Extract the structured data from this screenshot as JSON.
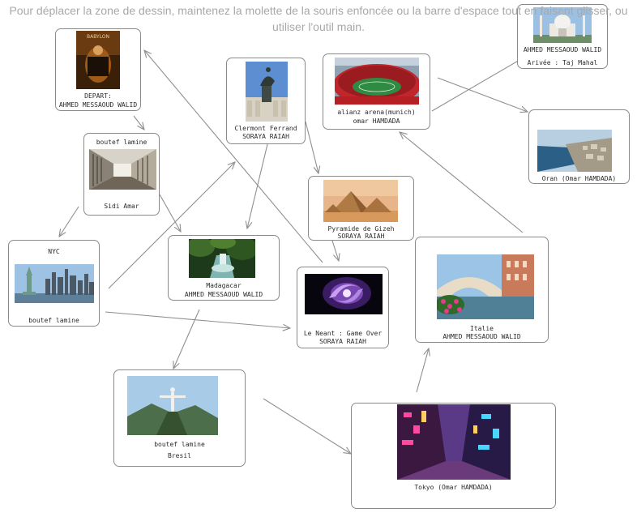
{
  "hint": "Pour déplacer la zone de dessin, maintenez la molette de la souris enfoncée ou la barre d'espace tout en faisant glisser, ou utiliser l'outil main.",
  "cards": {
    "depart": {
      "title": "DEPART:",
      "subtitle": "AHMED MESSAOUD WALID",
      "image_subject": "Babylon movie poster"
    },
    "boutef_sidi": {
      "title": "boutef lamine",
      "subtitle": "Sidi Amar",
      "image_subject": "prison corridor"
    },
    "nyc": {
      "title": "NYC",
      "subtitle": "boutef lamine",
      "image_subject": "Statue of Liberty and Manhattan skyline"
    },
    "clermont": {
      "title": "Clermont Ferrand",
      "subtitle": "SORAYA RAIAH",
      "image_subject": "equestrian statue and building"
    },
    "allianz": {
      "title": "alianz arena(munich)",
      "subtitle": "omar HAMDADA",
      "image_subject": "stadium"
    },
    "taj": {
      "title": "AHMED MESSAOUD WALID",
      "subtitle": "Arivée : Taj Mahal",
      "image_subject": "Taj Mahal"
    },
    "oran": {
      "title": "Oran (Omar HAMDADA)",
      "image_subject": "coastal city"
    },
    "pyramide": {
      "title": "Pyramide de Gizeh",
      "subtitle": "SORAYA RAIAH",
      "image_subject": "pyramids of Giza"
    },
    "madagascar": {
      "title": "Madagacar",
      "subtitle": "AHMED MESSAOUD WALID",
      "image_subject": "jungle waterfall"
    },
    "neant": {
      "title": "Le Neant : Game Over",
      "subtitle": "SORAYA RAIAH",
      "image_subject": "galaxy spiral"
    },
    "italie": {
      "title": "Italie",
      "subtitle": "AHMED MESSAOUD WALID",
      "image_subject": "Venice Rialto bridge"
    },
    "bresil": {
      "title": "boutef lamine",
      "subtitle": "Bresil",
      "image_subject": "Christ the Redeemer"
    },
    "tokyo": {
      "title": "Tokyo (Omar HAMDADA)",
      "image_subject": "neon street at night"
    }
  },
  "connections": [
    [
      "depart",
      "boutef_sidi"
    ],
    [
      "boutef_sidi",
      "nyc"
    ],
    [
      "boutef_sidi",
      "madagascar"
    ],
    [
      "nyc",
      "clermont"
    ],
    [
      "nyc",
      "neant"
    ],
    [
      "clermont",
      "madagascar"
    ],
    [
      "clermont",
      "pyramide"
    ],
    [
      "pyramide",
      "neant"
    ],
    [
      "neant",
      "depart"
    ],
    [
      "madagascar",
      "bresil"
    ],
    [
      "bresil",
      "tokyo"
    ],
    [
      "tokyo",
      "italie"
    ],
    [
      "italie",
      "allianz"
    ],
    [
      "allianz",
      "taj"
    ],
    [
      "allianz",
      "oran"
    ]
  ],
  "colors": {
    "card_border": "#8a8a8a",
    "arrow": "#8f8f8f",
    "hint_text": "#a8a8a8"
  }
}
